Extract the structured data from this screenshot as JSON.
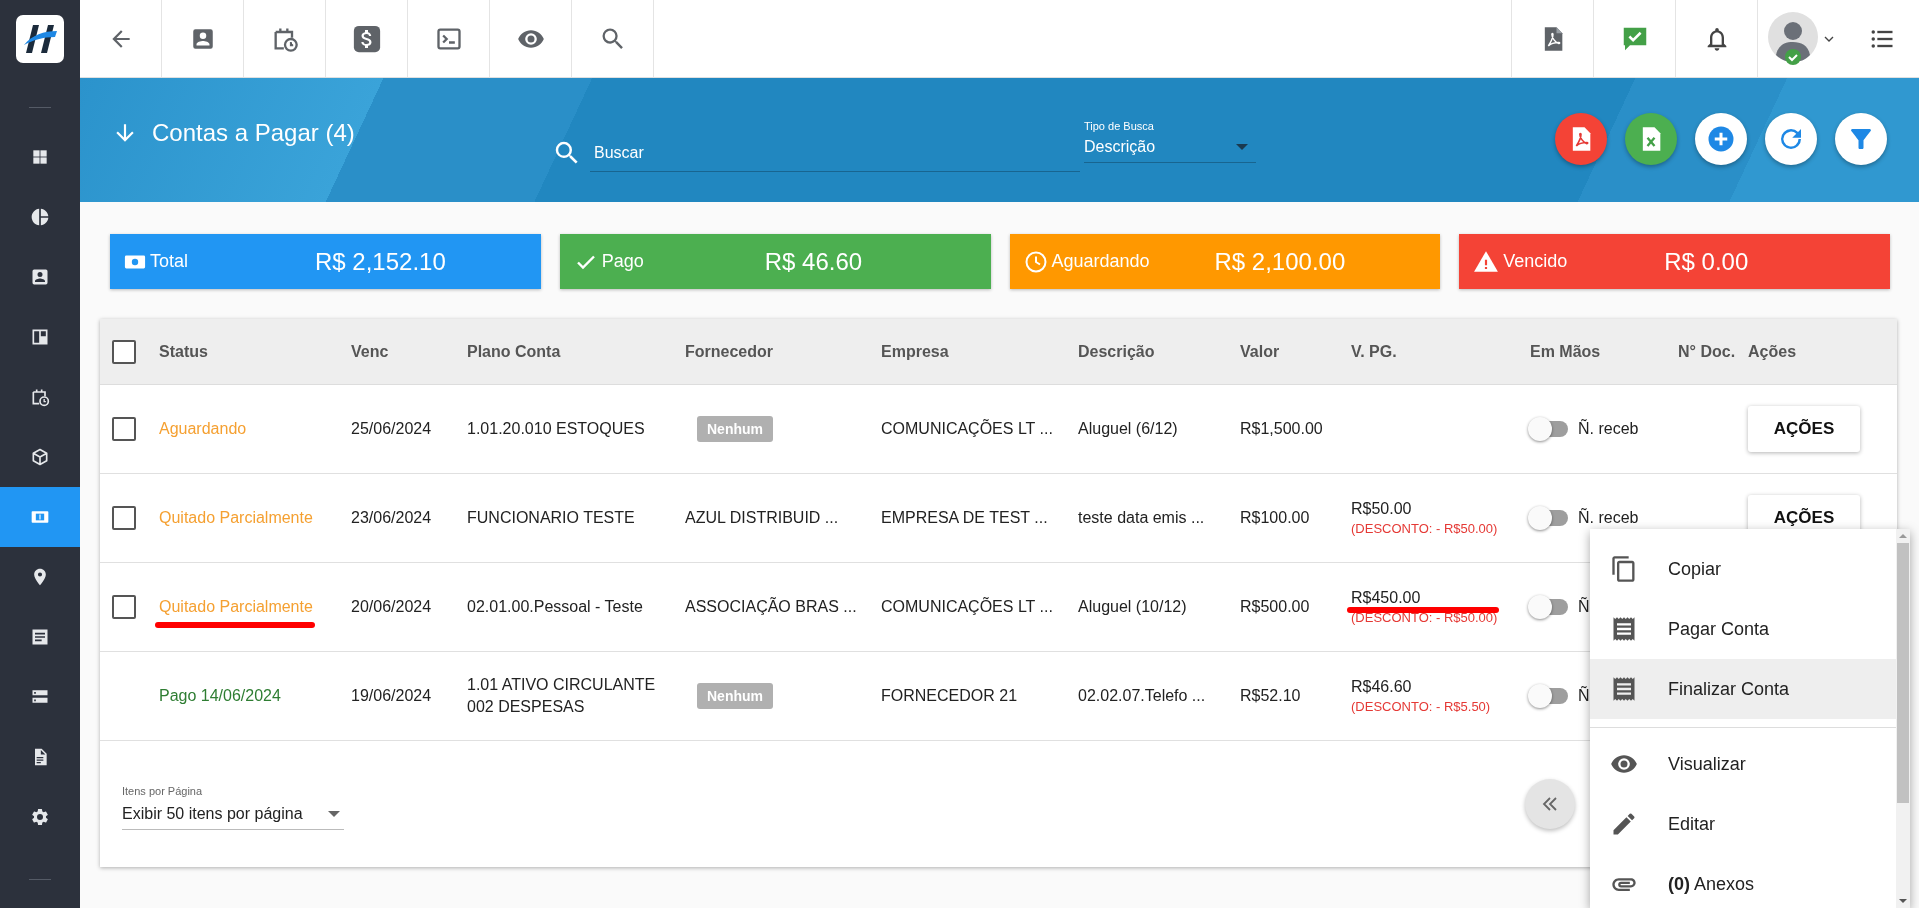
{
  "sidebar": {
    "items": [
      {
        "selected": false
      },
      {
        "selected": false
      },
      {
        "selected": false
      },
      {
        "selected": false
      },
      {
        "selected": false
      },
      {
        "selected": false
      },
      {
        "selected": true
      },
      {
        "selected": false
      },
      {
        "selected": false
      },
      {
        "selected": false
      },
      {
        "selected": false
      },
      {
        "selected": false
      }
    ]
  },
  "header": {
    "title": "Contas a Pagar (4)",
    "search": {
      "placeholder": "Buscar"
    },
    "search_type": {
      "label": "Tipo de Busca",
      "value": "Descrição"
    }
  },
  "summary": [
    {
      "kind": "total",
      "label": "Total",
      "value": "R$ 2,152.10",
      "color": "#2196f3"
    },
    {
      "kind": "paid",
      "label": "Pago",
      "value": "R$ 46.60",
      "color": "#4caf50"
    },
    {
      "kind": "pending",
      "label": "Aguardando",
      "value": "R$ 2,100.00",
      "color": "#ff9800"
    },
    {
      "kind": "overdue",
      "label": "Vencido",
      "value": "R$ 0.00",
      "color": "#f44336"
    }
  ],
  "table": {
    "columns": [
      "Status",
      "Venc",
      "Plano Conta",
      "Fornecedor",
      "Empresa",
      "Descrição",
      "Valor",
      "V. PG.",
      "Em Mãos",
      "N° Doc.",
      "Ações"
    ],
    "select_all": {
      "checked": false
    },
    "rows": [
      {
        "checked": false,
        "status": {
          "text": "Aguardando",
          "color": "#f5a031"
        },
        "due": "25/06/2024",
        "account_plan": "1.01.20.010 ESTOQUES",
        "supplier": {
          "kind": "badge",
          "text": "Nenhum"
        },
        "company": "COMUNICAÇÕES LT ...",
        "description": "Aluguel (6/12)",
        "amount": "R$1,500.00",
        "in_hand": {
          "on": false,
          "label": "Ñ. receb"
        },
        "actions": "AÇÕES"
      },
      {
        "checked": false,
        "status": {
          "text": "Quitado Parcialmente",
          "color": "#f5a031"
        },
        "due": "23/06/2024",
        "account_plan": "FUNCIONARIO TESTE",
        "supplier": {
          "kind": "text",
          "text": "AZUL DISTRIBUID ..."
        },
        "company": "EMPRESA DE TEST ...",
        "description": "teste data emis ...",
        "amount": "R$100.00",
        "paid": {
          "amount": "R$50.00",
          "discount": "(DESCONTO: - R$50.00)"
        },
        "in_hand": {
          "on": false,
          "label": "Ñ. receb"
        },
        "actions": "AÇÕES"
      },
      {
        "checked": false,
        "status": {
          "text": "Quitado Parcialmente",
          "color": "#f5a031",
          "marked": true
        },
        "due": "20/06/2024",
        "account_plan": "02.01.00.Pessoal - Teste",
        "supplier": {
          "kind": "text",
          "text": "ASSOCIAÇÃO BRAS ..."
        },
        "company": "COMUNICAÇÕES LT ...",
        "description": "Aluguel (10/12)",
        "amount": "R$500.00",
        "paid": {
          "amount": "R$450.00",
          "discount": "(DESCONTO: - R$50.00)",
          "marked": true
        },
        "in_hand": {
          "on": false,
          "label": "Ñ"
        }
      },
      {
        "status": {
          "text": "Pago 14/06/2024",
          "color": "#2e7d32"
        },
        "due": "19/06/2024",
        "account_plan": "1.01 ATIVO CIRCULANTE\n002 DESPESAS",
        "supplier": {
          "kind": "badge",
          "text": "Nenhum"
        },
        "company": "FORNECEDOR 21",
        "description": "02.02.07.Telefo ...",
        "amount": "R$52.10",
        "paid": {
          "amount": "R$46.60",
          "discount": "(DESCONTO: - R$5.50)"
        },
        "in_hand": {
          "on": false,
          "label": "Ñ"
        }
      }
    ]
  },
  "pagination": {
    "label": "Itens por Página",
    "value": "Exibir 50 itens por página"
  },
  "action_menu": {
    "groups": [
      [
        {
          "kind": "copy",
          "label": "Copiar",
          "selected": false
        },
        {
          "kind": "receipt",
          "label": "Pagar Conta",
          "selected": false
        },
        {
          "kind": "receipt",
          "label": "Finalizar Conta",
          "selected": true
        }
      ],
      [
        {
          "kind": "view",
          "label": "Visualizar",
          "selected": false
        },
        {
          "kind": "edit",
          "label": "Editar",
          "selected": false
        },
        {
          "kind": "attach",
          "label": "**(0)** Anexos",
          "selected": false
        }
      ]
    ]
  }
}
